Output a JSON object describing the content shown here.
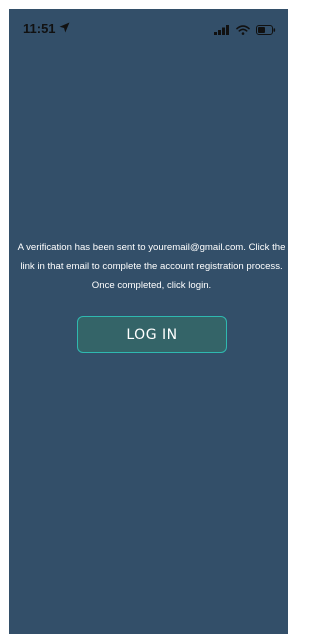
{
  "status_bar": {
    "time": "11:51",
    "icons": [
      "location-arrow-icon",
      "cellular-signal-icon",
      "wifi-icon",
      "battery-icon"
    ]
  },
  "verification": {
    "message": "A verification has been sent to youremail@gmail.com. Click the link in that email to complete the account registration process. Once completed, click login.",
    "login_label": "LOG IN"
  },
  "colors": {
    "background": "#334f69",
    "button_border": "#2fb9b0",
    "button_fill": "#346468",
    "text": "#ffffff"
  }
}
